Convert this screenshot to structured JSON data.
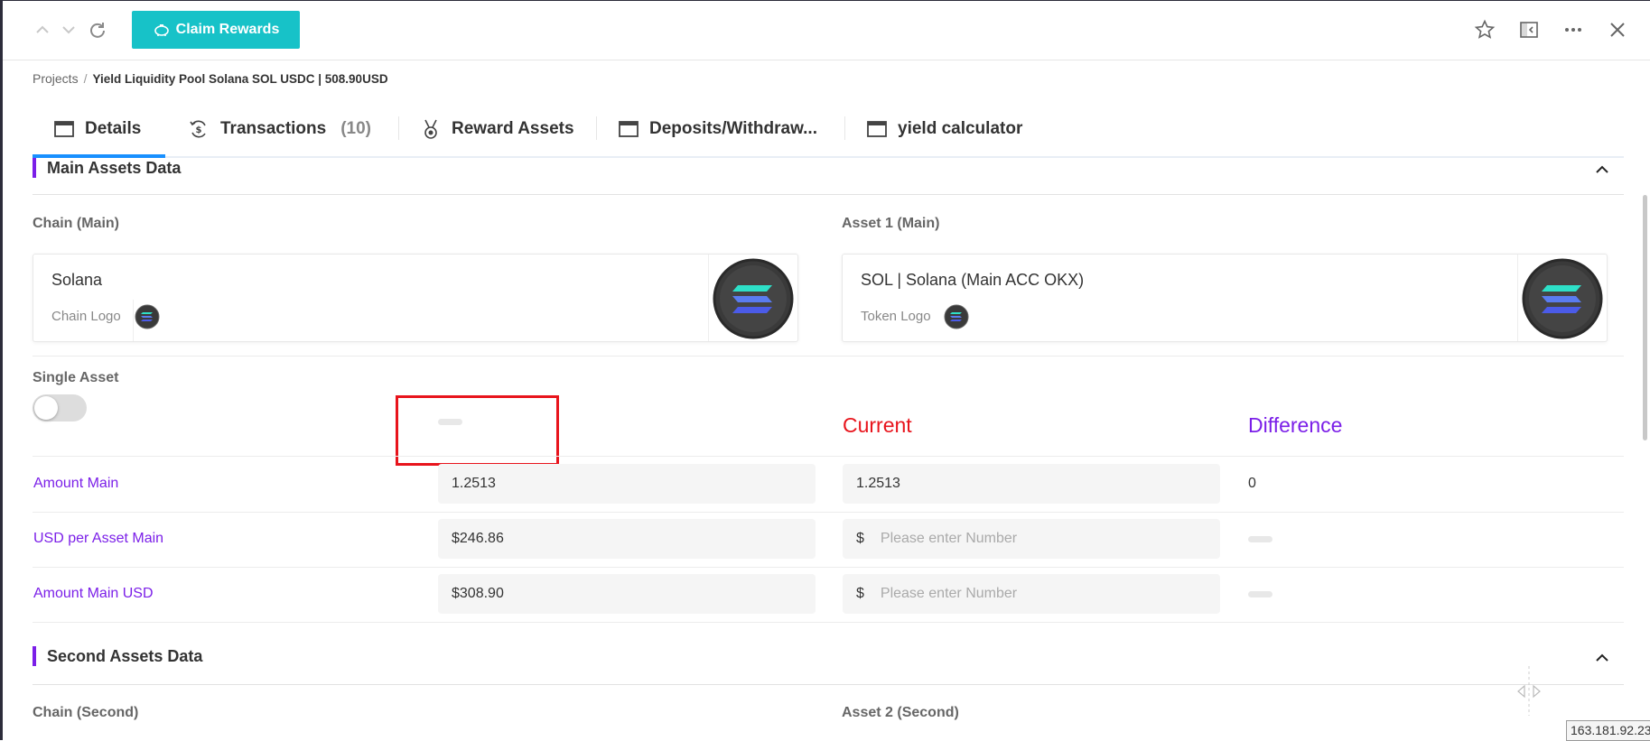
{
  "toolbar": {
    "claim_label": "Claim Rewards"
  },
  "breadcrumb": {
    "root": "Projects",
    "separator": "/",
    "current": "Yield Liquidity Pool Solana SOL USDC | 508.90USD"
  },
  "tabs": [
    {
      "label": "Details",
      "count": ""
    },
    {
      "label": "Transactions",
      "count": "(10)"
    },
    {
      "label": "Reward Assets",
      "count": ""
    },
    {
      "label": "Deposits/Withdraw...",
      "count": ""
    },
    {
      "label": "yield calculator",
      "count": ""
    }
  ],
  "main_section": {
    "title": "Main Assets Data",
    "chain_label": "Chain (Main)",
    "asset_label": "Asset 1 (Main)",
    "chain_card": {
      "name": "Solana",
      "logo_label": "Chain Logo"
    },
    "asset_card": {
      "name": "SOL | Solana (Main ACC OKX)",
      "logo_label": "Token Logo"
    },
    "single_asset_label": "Single Asset",
    "single_asset_on": false,
    "col_current": "Current",
    "col_difference": "Difference",
    "rows": [
      {
        "label": "Amount Main",
        "initial": "1.2513",
        "current": "1.2513",
        "current_prefix": "",
        "current_placeholder": "",
        "difference": "0"
      },
      {
        "label": "USD per Asset Main",
        "initial": "$246.86",
        "current": "",
        "current_prefix": "$",
        "current_placeholder": "Please enter Number",
        "difference": ""
      },
      {
        "label": "Amount Main USD",
        "initial": "$308.90",
        "current": "",
        "current_prefix": "$",
        "current_placeholder": "Please enter Number",
        "difference": ""
      }
    ]
  },
  "second_section": {
    "title": "Second Assets Data",
    "chain_label": "Chain (Second)",
    "asset_label": "Asset 2 (Second)"
  },
  "status": {
    "ip": "163.181.92.23"
  },
  "colors": {
    "accent_teal": "#17c2c8",
    "accent_purple": "#7b1fe8",
    "tab_active": "#1890ff",
    "current_header": "#e8141c",
    "difference_header": "#7b1fe8",
    "annotation_box": "#e8141c"
  },
  "icons": {
    "nav_up": "chevron-up-icon",
    "nav_down": "chevron-down-icon",
    "refresh": "refresh-icon",
    "piggy": "piggy-bank-icon",
    "star": "star-icon",
    "sidebar": "sidebar-toggle-icon",
    "more": "more-icon",
    "close": "close-icon"
  }
}
